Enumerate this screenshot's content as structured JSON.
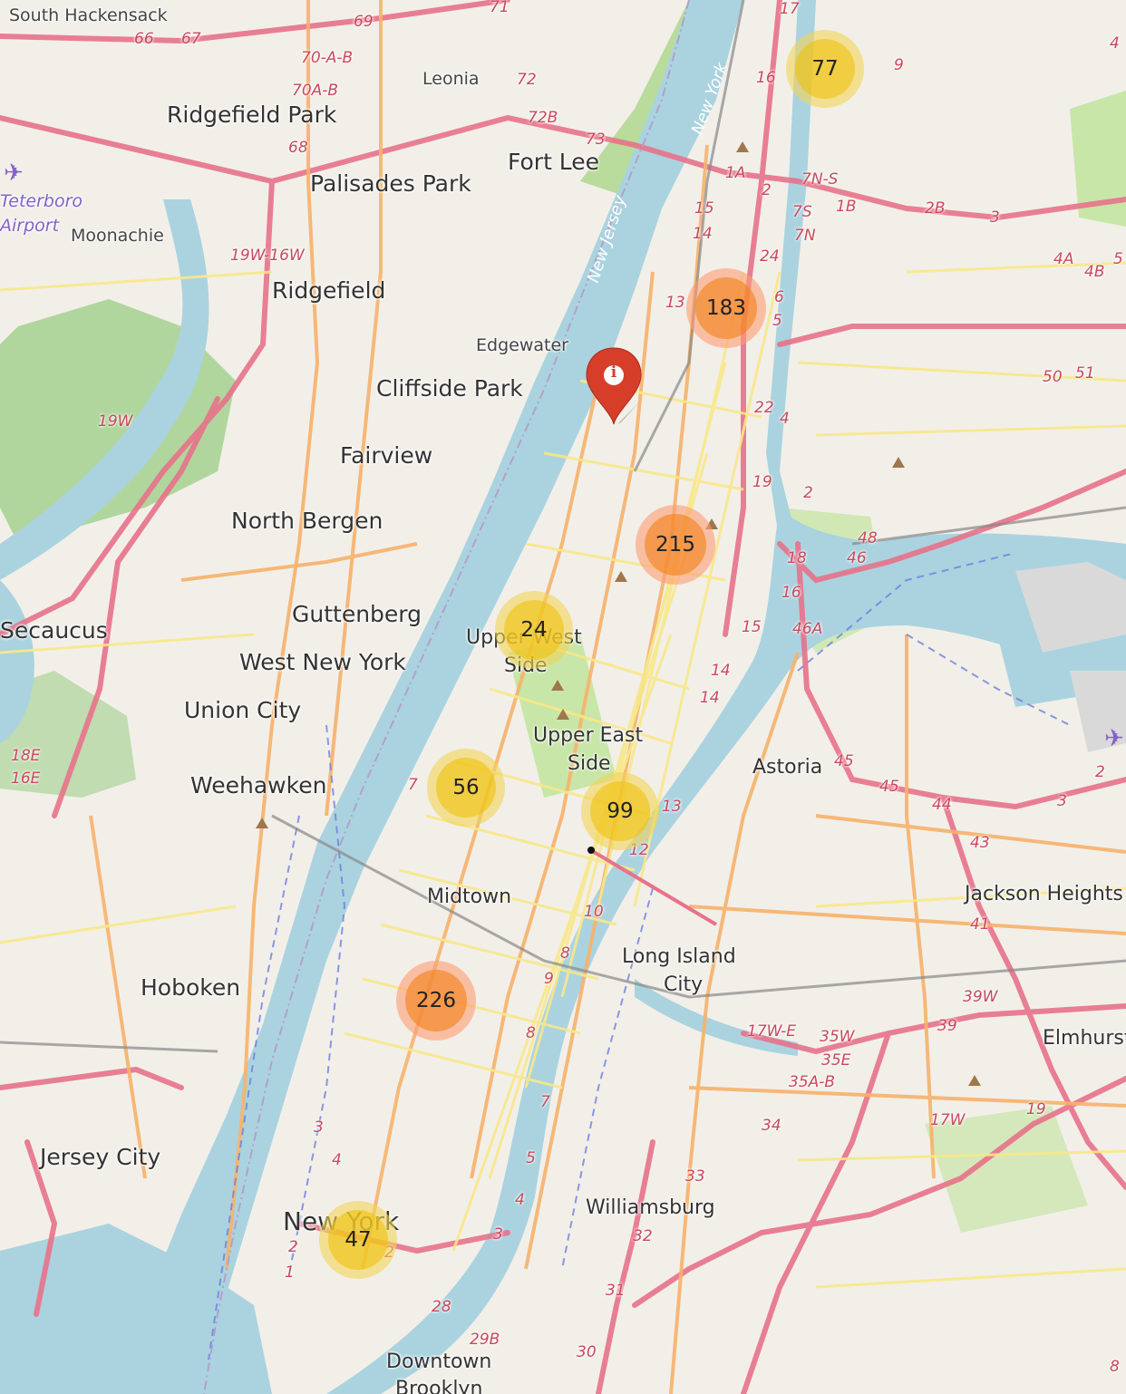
{
  "colors": {
    "land": "#f2efe9",
    "water": "#aad3df",
    "park": "#c8e6a8",
    "wetland": "#9fcf8a",
    "road_major": "#e8728a",
    "road_trunk": "#f7b26b",
    "road_secondary": "#f8e88a",
    "cluster_medium": "#f0c20c",
    "cluster_large": "#f18017",
    "marker_red": "#d63e2a"
  },
  "places": [
    {
      "text": "South Hackensack",
      "size": "small"
    },
    {
      "text": "Leonia",
      "size": "small"
    },
    {
      "text": "Ridgefield Park",
      "size": "big"
    },
    {
      "text": "Fort Lee",
      "size": "big"
    },
    {
      "text": "Palisades Park",
      "size": "big"
    },
    {
      "text": "Moonachie",
      "size": "small"
    },
    {
      "text": "Ridgefield",
      "size": "big"
    },
    {
      "text": "Edgewater",
      "size": "small"
    },
    {
      "text": "Cliffside Park",
      "size": "big"
    },
    {
      "text": "Fairview",
      "size": "big"
    },
    {
      "text": "North Bergen",
      "size": "big"
    },
    {
      "text": "Secaucus",
      "size": "big"
    },
    {
      "text": "Guttenberg",
      "size": "big"
    },
    {
      "text": "West New York",
      "size": "big"
    },
    {
      "text": "Union City",
      "size": "big"
    },
    {
      "text": "Weehawken",
      "size": "big"
    },
    {
      "text": "Upper West",
      "size": "mid"
    },
    {
      "text": "Side",
      "size": "mid"
    },
    {
      "text": "Upper East",
      "size": "mid"
    },
    {
      "text": "Side",
      "size": "mid"
    },
    {
      "text": "Astoria",
      "size": "mid"
    },
    {
      "text": "Midtown",
      "size": "mid"
    },
    {
      "text": "Long Island",
      "size": "mid"
    },
    {
      "text": "City",
      "size": "mid"
    },
    {
      "text": "Hoboken",
      "size": "big"
    },
    {
      "text": "Jackson Heights",
      "size": "mid"
    },
    {
      "text": "Elmhurst",
      "size": "mid"
    },
    {
      "text": "Jersey City",
      "size": "big"
    },
    {
      "text": "New York",
      "size": "big"
    },
    {
      "text": "Williamsburg",
      "size": "mid"
    },
    {
      "text": "Downtown",
      "size": "mid"
    },
    {
      "text": "Brooklyn",
      "size": "mid"
    },
    {
      "text": "Teterboro",
      "size": "small"
    },
    {
      "text": "Airport",
      "size": "small"
    }
  ],
  "water_labels": [
    "New York",
    "New Jersey"
  ],
  "route_shields": [
    "69",
    "66",
    "67",
    "70-A-B",
    "70A-B",
    "72",
    "72B",
    "73",
    "71",
    "68",
    "19W-16W",
    "19W",
    "18E",
    "16E",
    "17",
    "16",
    "9",
    "1A",
    "7N-S",
    "7S",
    "7N",
    "2",
    "1B",
    "2B",
    "3",
    "15",
    "14",
    "24",
    "13",
    "6",
    "5",
    "22",
    "4",
    "19",
    "48",
    "46",
    "18",
    "16",
    "15",
    "46A",
    "14",
    "14",
    "45",
    "45",
    "44",
    "43",
    "41",
    "39W",
    "39",
    "7",
    "13",
    "12",
    "10",
    "8",
    "9",
    "8",
    "7",
    "5",
    "4",
    "3",
    "4",
    "3",
    "2",
    "1",
    "2",
    "28",
    "29B",
    "30",
    "31",
    "32",
    "33",
    "34",
    "35W",
    "35E",
    "35A-B",
    "17W-E",
    "17W",
    "19",
    "4A",
    "4B",
    "5",
    "50",
    "51",
    "2",
    "3",
    "4",
    "8",
    "2"
  ],
  "clusters": [
    {
      "count": "77",
      "tier": "medium"
    },
    {
      "count": "183",
      "tier": "large"
    },
    {
      "count": "215",
      "tier": "large"
    },
    {
      "count": "24",
      "tier": "medium"
    },
    {
      "count": "56",
      "tier": "medium"
    },
    {
      "count": "99",
      "tier": "medium"
    },
    {
      "count": "226",
      "tier": "large"
    },
    {
      "count": "47",
      "tier": "medium"
    }
  ],
  "info_marker": {
    "icon": "info-icon",
    "glyph": "i"
  },
  "icons": {
    "airport": "airplane-icon",
    "peak": "peak-icon"
  }
}
